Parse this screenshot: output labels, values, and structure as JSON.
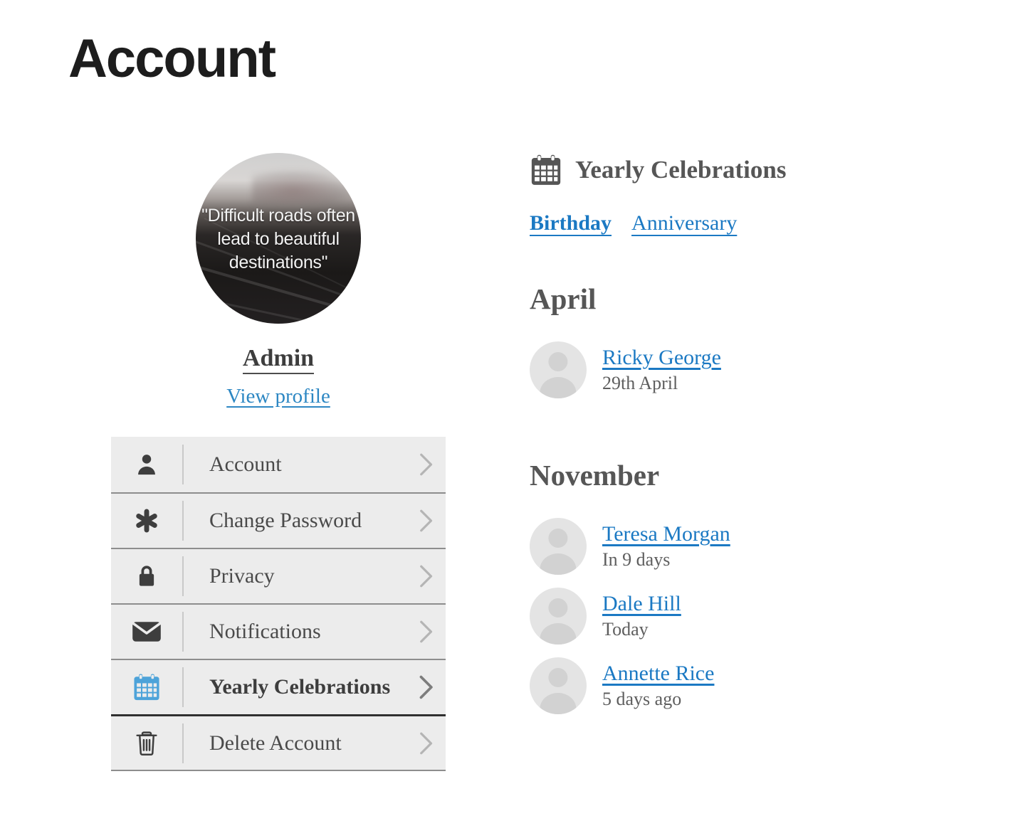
{
  "page": {
    "title": "Account"
  },
  "profile": {
    "avatar_quote": "\"Difficult roads often lead to beautiful destinations\"",
    "avatar_alt": "profile-photo-road-quote",
    "name": "Admin",
    "view_profile_label": "View profile"
  },
  "settings_menu": {
    "items": [
      {
        "label": "Account",
        "icon": "person-icon",
        "active": false
      },
      {
        "label": "Change Password",
        "icon": "asterisk-icon",
        "active": false
      },
      {
        "label": "Privacy",
        "icon": "lock-icon",
        "active": false
      },
      {
        "label": "Notifications",
        "icon": "envelope-icon",
        "active": false
      },
      {
        "label": "Yearly Celebrations",
        "icon": "calendar-icon",
        "active": true
      },
      {
        "label": "Delete Account",
        "icon": "trash-icon",
        "active": false
      }
    ]
  },
  "panel": {
    "icon": "calendar-icon",
    "title": "Yearly Celebrations",
    "tabs": [
      {
        "label": "Birthday",
        "active": true
      },
      {
        "label": "Anniversary",
        "active": false
      }
    ],
    "groups": [
      {
        "month": "April",
        "people": [
          {
            "name": "Ricky George",
            "date": "29th April",
            "avatar": "default-avatar"
          }
        ]
      },
      {
        "month": "November",
        "people": [
          {
            "name": "Teresa Morgan",
            "date": "In 9 days",
            "avatar": "default-avatar"
          },
          {
            "name": "Dale Hill",
            "date": "Today",
            "avatar": "default-avatar"
          },
          {
            "name": "Annette Rice",
            "date": "5 days ago",
            "avatar": "default-avatar"
          }
        ]
      }
    ]
  },
  "colors": {
    "link_blue": "#1b79c3",
    "accent_calendar_blue": "#4da3d9",
    "menu_bg": "#ececec",
    "menu_border": "#8d8d8d",
    "heading_gray": "#565656",
    "title_black": "#1d1d1d"
  }
}
